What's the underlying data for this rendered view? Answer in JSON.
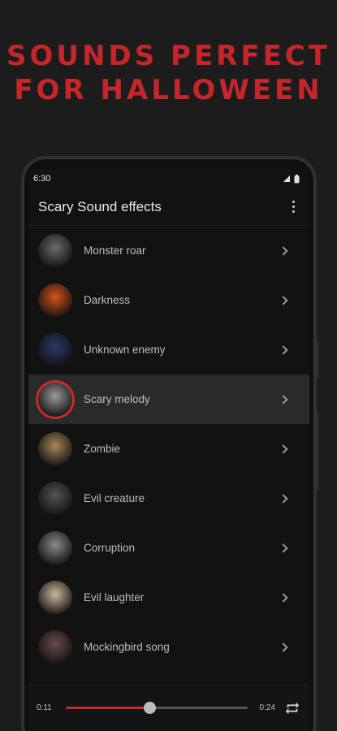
{
  "promo": {
    "line1": "SOUNDS PERFECT",
    "line2": "FOR HALLOWEEN"
  },
  "status": {
    "time": "6:30"
  },
  "app": {
    "title": "Scary Sound effects"
  },
  "sounds": [
    {
      "label": "Monster roar",
      "thumb_color": "#6b6b6b"
    },
    {
      "label": "Darkness",
      "thumb_color": "#d8521a"
    },
    {
      "label": "Unknown enemy",
      "thumb_color": "#2b3a66"
    },
    {
      "label": "Scary melody",
      "thumb_color": "#9a9a9a",
      "active": true
    },
    {
      "label": "Zombie",
      "thumb_color": "#a8865a"
    },
    {
      "label": "Evil creature",
      "thumb_color": "#555555"
    },
    {
      "label": "Corruption",
      "thumb_color": "#8a8a8a"
    },
    {
      "label": "Evil laughter",
      "thumb_color": "#c9b99a"
    },
    {
      "label": "Mockingbird song",
      "thumb_color": "#6a4a4a"
    }
  ],
  "player": {
    "elapsed": "0:11",
    "duration": "0:24",
    "progress": 0.46
  },
  "colors": {
    "accent": "#c72a2a",
    "promo": "#c4262b"
  }
}
